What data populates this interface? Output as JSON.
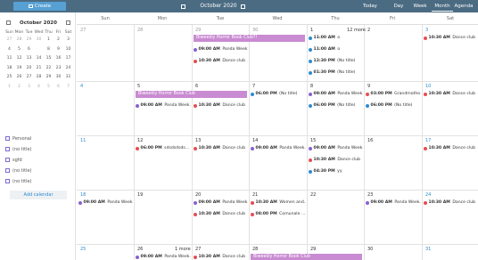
{
  "header": {
    "create_label": "Create",
    "title": "October 2020",
    "views": [
      "Today",
      "Day",
      "Week",
      "Month",
      "Agenda"
    ],
    "active_view": "Month"
  },
  "mini_calendar": {
    "title": "October 2020",
    "weekdays": [
      "Sun",
      "Mon",
      "Tue",
      "Wed",
      "Thu",
      "Fri",
      "Sat"
    ],
    "weeks": [
      [
        "27",
        "28",
        "29",
        "30",
        "1",
        "2",
        "3"
      ],
      [
        "4",
        "5",
        "6",
        "7",
        "8",
        "9",
        "10"
      ],
      [
        "11",
        "12",
        "13",
        "14",
        "15",
        "16",
        "17"
      ],
      [
        "18",
        "19",
        "20",
        "21",
        "22",
        "23",
        "24"
      ],
      [
        "25",
        "26",
        "27",
        "28",
        "29",
        "30",
        "31"
      ],
      [
        "1",
        "2",
        "3",
        "4",
        "5",
        "6",
        "7"
      ]
    ],
    "today": "7"
  },
  "calendars": [
    "Personal",
    "(no title)",
    "sgfd",
    "(no title)",
    "(no title)"
  ],
  "add_calendar_label": "Add calendar",
  "month": {
    "weekdays": [
      "Sun",
      "Mon",
      "Tue",
      "Wed",
      "Thu",
      "Fri",
      "Sat"
    ],
    "weeks": [
      [
        "27",
        "28",
        "29",
        "30",
        "1",
        "2",
        "3"
      ],
      [
        "4",
        "5",
        "6",
        "7",
        "8",
        "9",
        "10"
      ],
      [
        "11",
        "12",
        "13",
        "14",
        "15",
        "16",
        "17"
      ],
      [
        "18",
        "19",
        "20",
        "21",
        "22",
        "23",
        "24"
      ],
      [
        "25",
        "26",
        "27",
        "28",
        "29",
        "30",
        "31"
      ]
    ],
    "more": [
      {
        "week": 0,
        "day": 4,
        "label": "12 more"
      },
      {
        "week": 4,
        "day": 1,
        "label": "1 more"
      }
    ],
    "bars": [
      {
        "week": 0,
        "start": 2,
        "span": 2,
        "title": "Biweekly Horror Book Club?!"
      },
      {
        "week": 1,
        "start": 1,
        "span": 2,
        "title": "Biweekly Horror Book Club"
      },
      {
        "week": 4,
        "start": 3,
        "span": 2,
        "title": "Biweekly Horror Book Club"
      }
    ],
    "events": [
      {
        "week": 0,
        "day": 2,
        "slot": 1,
        "color": "purple",
        "time": "09:00 AM",
        "title": "Panda Week..."
      },
      {
        "week": 0,
        "day": 2,
        "slot": 2,
        "color": "red",
        "time": "10:30 AM",
        "title": "Dance club"
      },
      {
        "week": 0,
        "day": 4,
        "slot": 0,
        "color": "blue",
        "time": "11:00 AM",
        "title": "o"
      },
      {
        "week": 0,
        "day": 4,
        "slot": 1,
        "color": "blue",
        "time": "11:00 AM",
        "title": "o"
      },
      {
        "week": 0,
        "day": 4,
        "slot": 2,
        "color": "blue",
        "time": "12:30 PM",
        "title": "(No title)"
      },
      {
        "week": 0,
        "day": 4,
        "slot": 3,
        "color": "blue",
        "time": "01:30 PM",
        "title": "(No title)"
      },
      {
        "week": 0,
        "day": 6,
        "slot": 0,
        "color": "red",
        "time": "10:30 AM",
        "title": "Dance club"
      },
      {
        "week": 1,
        "day": 1,
        "slot": 1,
        "color": "purple",
        "time": "09:00 AM",
        "title": "Panda Week..."
      },
      {
        "week": 1,
        "day": 2,
        "slot": 1,
        "color": "red",
        "time": "10:30 AM",
        "title": "Dance club"
      },
      {
        "week": 1,
        "day": 3,
        "slot": 0,
        "color": "blue",
        "time": "06:00 PM",
        "title": "(No title)"
      },
      {
        "week": 1,
        "day": 4,
        "slot": 0,
        "color": "purple",
        "time": "09:00 AM",
        "title": "Panda Week..."
      },
      {
        "week": 1,
        "day": 4,
        "slot": 1,
        "color": "blue",
        "time": "06:00 PM",
        "title": "(No title)"
      },
      {
        "week": 1,
        "day": 5,
        "slot": 0,
        "color": "red",
        "time": "03:00 PM",
        "title": "Grandmothe..."
      },
      {
        "week": 1,
        "day": 5,
        "slot": 1,
        "color": "blue",
        "time": "06:00 PM",
        "title": "(No title)"
      },
      {
        "week": 1,
        "day": 6,
        "slot": 0,
        "color": "red",
        "time": "10:30 AM",
        "title": "Dance club"
      },
      {
        "week": 2,
        "day": 1,
        "slot": 0,
        "color": "red",
        "time": "06:00 PM",
        "title": "sdsdsdsds..."
      },
      {
        "week": 2,
        "day": 2,
        "slot": 0,
        "color": "red",
        "time": "10:30 AM",
        "title": "Dance club"
      },
      {
        "week": 2,
        "day": 3,
        "slot": 0,
        "color": "purple",
        "time": "09:00 AM",
        "title": "Panda Week..."
      },
      {
        "week": 2,
        "day": 4,
        "slot": 0,
        "color": "purple",
        "time": "09:00 AM",
        "title": "Panda Week..."
      },
      {
        "week": 2,
        "day": 4,
        "slot": 1,
        "color": "red",
        "time": "10:30 AM",
        "title": "Dance club"
      },
      {
        "week": 2,
        "day": 4,
        "slot": 2,
        "color": "blue",
        "time": "04:30 PM",
        "title": "yy"
      },
      {
        "week": 2,
        "day": 6,
        "slot": 0,
        "color": "red",
        "time": "10:30 AM",
        "title": "Dance club"
      },
      {
        "week": 3,
        "day": 0,
        "slot": 0,
        "color": "purple",
        "time": "09:00 AM",
        "title": "Panda Week..."
      },
      {
        "week": 3,
        "day": 2,
        "slot": 0,
        "color": "purple",
        "time": "09:00 AM",
        "title": "Panda Week..."
      },
      {
        "week": 3,
        "day": 2,
        "slot": 1,
        "color": "red",
        "time": "10:30 AM",
        "title": "Dance club"
      },
      {
        "week": 3,
        "day": 3,
        "slot": 0,
        "color": "red",
        "time": "10:30 AM",
        "title": "Women and..."
      },
      {
        "week": 3,
        "day": 3,
        "slot": 1,
        "color": "red",
        "time": "08:00 PM",
        "title": "Comunale ..."
      },
      {
        "week": 3,
        "day": 5,
        "slot": 0,
        "color": "purple",
        "time": "09:00 AM",
        "title": "Panda Week..."
      },
      {
        "week": 3,
        "day": 6,
        "slot": 0,
        "color": "red",
        "time": "10:30 AM",
        "title": "Dance club"
      },
      {
        "week": 4,
        "day": 1,
        "slot": 0,
        "color": "purple",
        "time": "09:00 AM",
        "title": "Panda Week..."
      },
      {
        "week": 4,
        "day": 2,
        "slot": 0,
        "color": "red",
        "time": "10:30 AM",
        "title": "Dance club"
      },
      {
        "week": 4,
        "day": 5,
        "slot": 1,
        "color": "purple",
        "time": "09:00 AM",
        "title": "Panda Week..."
      },
      {
        "week": 4,
        "day": 6,
        "slot": 1,
        "color": "red",
        "time": "10:30 AM",
        "title": "Dance club"
      }
    ]
  }
}
